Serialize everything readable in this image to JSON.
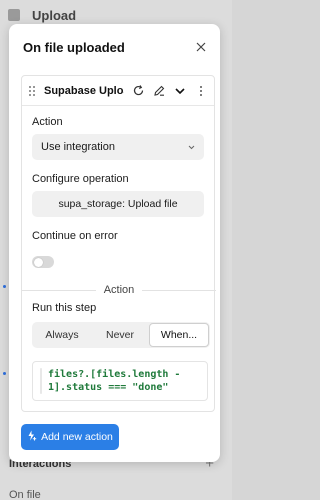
{
  "background": {
    "title": "Upload",
    "interactions_label": "Interactions",
    "on_file_label": "On file"
  },
  "modal": {
    "title": "On file uploaded",
    "card": {
      "title": "Supabase Upload ...",
      "action": {
        "label": "Action",
        "value": "Use integration"
      },
      "operation": {
        "label": "Configure operation",
        "value": "supa_storage: Upload file"
      },
      "continue_on_error": {
        "label": "Continue on error",
        "enabled": false
      },
      "divider_label": "Action",
      "run_step": {
        "label": "Run this step",
        "options": [
          "Always",
          "Never",
          "When..."
        ],
        "selected": "When..."
      },
      "condition_code_line1": "files?.[files.length -",
      "condition_code_line2": "1].status === \"done\""
    },
    "add_button_label": "Add new action"
  },
  "colors": {
    "primary": "#2b7fe6",
    "code_green": "#1f7a3b"
  }
}
